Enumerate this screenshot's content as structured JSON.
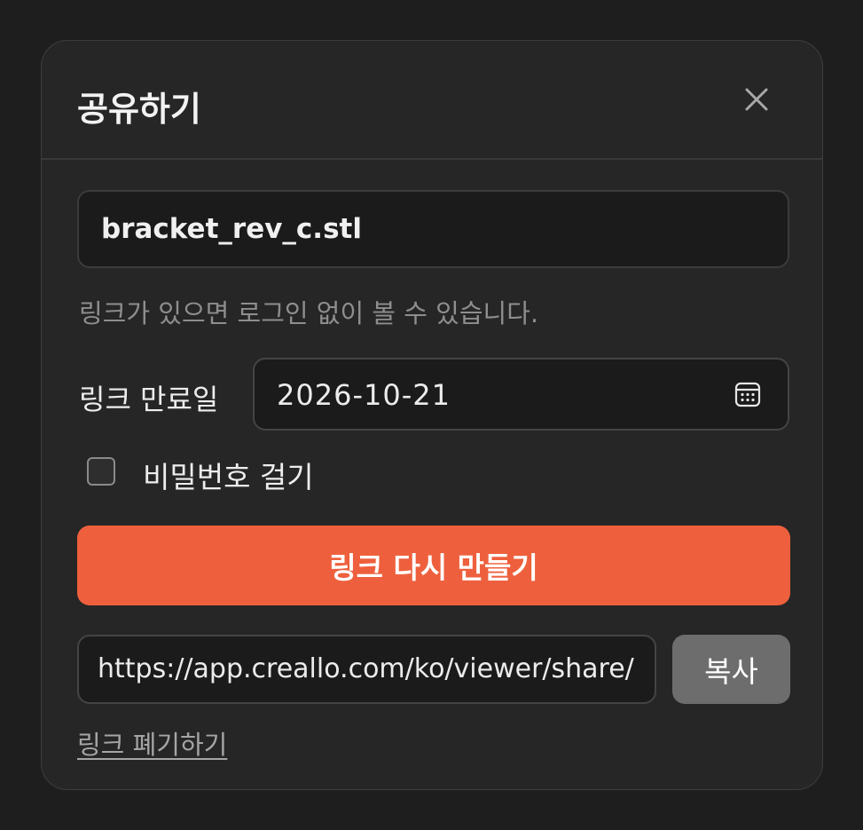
{
  "dialog": {
    "title": "공유하기",
    "close_icon": "close-icon",
    "file_name": "bracket_rev_c.stl",
    "hint": "링크가 있으면 로그인 없이 볼 수 있습니다.",
    "expiry": {
      "label": "링크 만료일",
      "value": "2026-10-21",
      "icon": "calendar-icon"
    },
    "password": {
      "label": "비밀번호 걸기",
      "checked": false
    },
    "regenerate_label": "링크 다시 만들기",
    "share_url": "https://app.creallo.com/ko/viewer/share/",
    "copy_label": "복사",
    "revoke_label": "링크 폐기하기"
  },
  "colors": {
    "background": "#1e1e1e",
    "dialog": "#262626",
    "accent": "#ee603d",
    "copy_button": "#6d6d6d"
  }
}
